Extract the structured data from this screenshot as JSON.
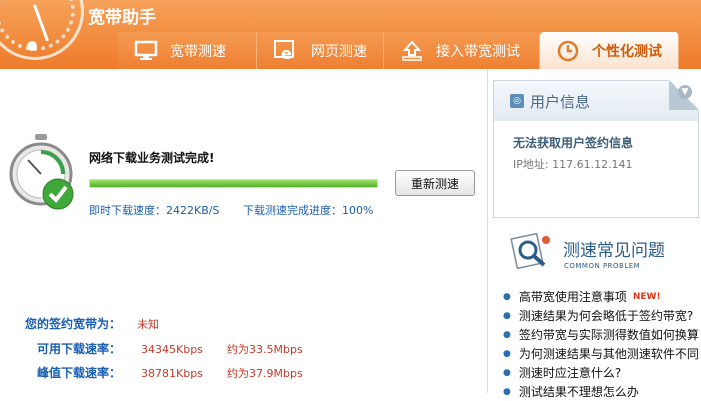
{
  "app": {
    "title": "宽带助手"
  },
  "tabs": [
    {
      "label": "宽带测速",
      "icon": "monitor-icon"
    },
    {
      "label": "网页测速",
      "icon": "browser-icon"
    },
    {
      "label": "接入带宽测试",
      "icon": "upload-icon"
    },
    {
      "label": "个性化测试",
      "icon": "clock-icon",
      "active": true
    }
  ],
  "result": {
    "title": "网络下载业务测试完成!",
    "progress": 1.0,
    "retest_label": "重新测速",
    "instant_speed": "即时下载速度：2422KB/S",
    "completion": "下载测速完成进度：100%"
  },
  "bandwidth": {
    "contract_label": "您的签约宽带为：",
    "contract_value": "未知",
    "available_label": "可用下载速率：",
    "available_kbps": "34345Kbps",
    "available_mbps": "约为33.5Mbps",
    "peak_label": "峰值下载速率：",
    "peak_kbps": "38781Kbps",
    "peak_mbps": "约为37.9Mbps"
  },
  "user_info": {
    "title": "用户信息",
    "message": "无法获取用户签约信息",
    "ip": "IP地址: 117.61.12.141"
  },
  "faq": {
    "title": "测速常见问题",
    "subtitle": "COMMON PROBLEM",
    "items": [
      {
        "text": "高带宽使用注意事项",
        "badge": "NEW!"
      },
      {
        "text": "测速结果为何会略低于签约带宽?"
      },
      {
        "text": "签约带宽与实际测得数值如何换算"
      },
      {
        "text": "为何测速结果与其他测速软件不同"
      },
      {
        "text": "测速时应注意什么?"
      },
      {
        "text": "测试结果不理想怎么办"
      }
    ]
  },
  "colors": {
    "header": "#ee7b29",
    "accent_blue": "#1a5fb4",
    "value_red": "#c43a2a",
    "progress_green": "#4fb227"
  }
}
